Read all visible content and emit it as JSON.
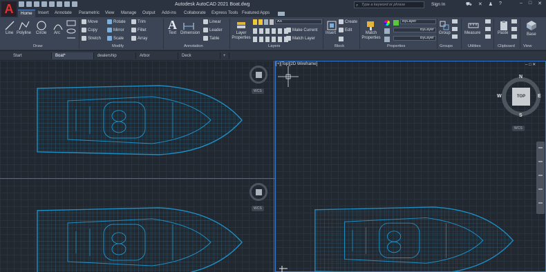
{
  "titlebar": {
    "logo": "A",
    "title": "Autodesk AutoCAD 2021   Boat.dwg",
    "search_placeholder": "Type a keyword or phrase",
    "signin": "Sign In"
  },
  "ribbon_tabs": [
    "Home",
    "Insert",
    "Annotate",
    "Parametric",
    "View",
    "Manage",
    "Output",
    "Add-ins",
    "Collaborate",
    "Express Tools",
    "Featured Apps"
  ],
  "draw": {
    "line": "Line",
    "polyline": "Polyline",
    "circle": "Circle",
    "arc": "Arc",
    "footer": "Draw"
  },
  "modify": {
    "move": "Move",
    "rotate": "Rotate",
    "trim": "Trim",
    "copy": "Copy",
    "mirror": "Mirror",
    "fillet": "Fillet",
    "stretch": "Stretch",
    "scale": "Scale",
    "array": "Array",
    "footer": "Modify"
  },
  "annotation": {
    "text": "Text",
    "dimension": "Dimension",
    "linear": "Linear",
    "leader": "Leader",
    "table": "Table",
    "footer": "Annotation"
  },
  "layers": {
    "layer_properties": "Layer Properties",
    "layer_name": "AX",
    "make_current": "Make Current",
    "match_layer": "Match Layer",
    "footer": "Layers"
  },
  "block": {
    "insert": "Insert",
    "create": "Create",
    "edit": "Edit",
    "footer": "Block"
  },
  "properties": {
    "match_properties": "Match Properties",
    "color": "ByLayer",
    "linetype": "ByLayer",
    "lineweight": "ByLayer",
    "footer": "Properties"
  },
  "groups": {
    "group": "Group",
    "footer": "Groups"
  },
  "utilities": {
    "measure": "Measure",
    "footer": "Utilities"
  },
  "clipboard": {
    "paste": "Paste",
    "footer": "Clipboard"
  },
  "view": {
    "base": "Base",
    "footer": "View"
  },
  "doc_tabs": [
    "Start",
    "Boat*",
    "dealership",
    "Arbor",
    "Deck"
  ],
  "viewport": {
    "label": "[+][Top][2D Wireframe]",
    "cube_top": "TOP",
    "north": "N",
    "south": "S",
    "east": "E",
    "west": "W",
    "wcs": "WCS"
  },
  "colors": {
    "boat": "#1e8fc4",
    "ribbon": "#3b4556",
    "canvas": "#212830",
    "active_border": "#3a7bd5"
  }
}
